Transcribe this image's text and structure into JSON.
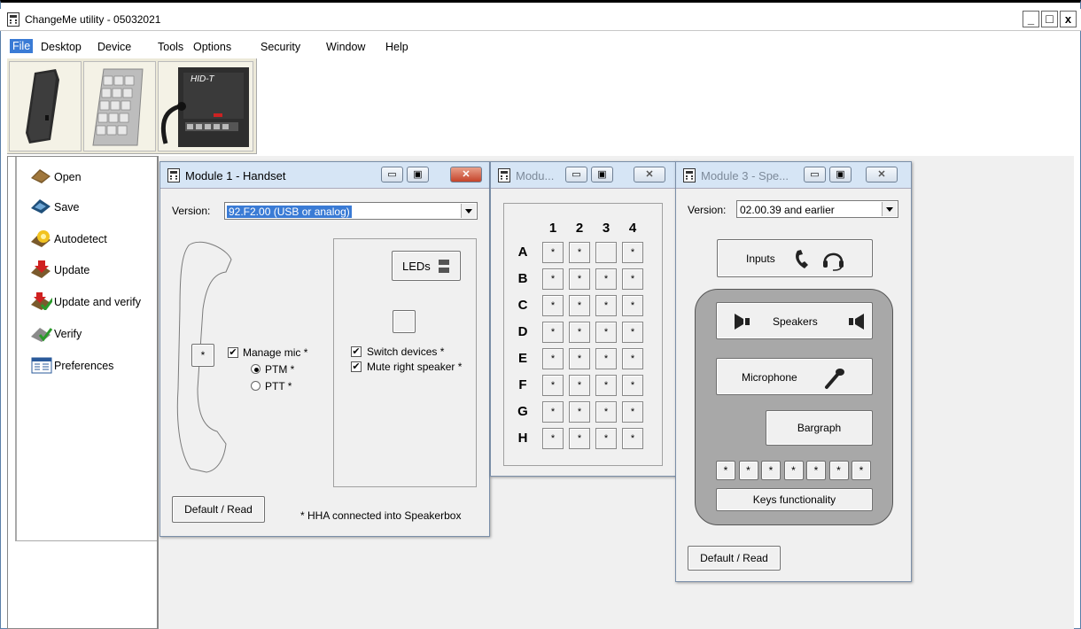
{
  "app": {
    "title": "ChangeMe utility - 05032021",
    "window_buttons": {
      "minimize": "_",
      "maximize": "□",
      "close": "x"
    }
  },
  "menu": [
    "File",
    "Desktop",
    "Device",
    "Tools",
    "Options",
    "Security",
    "Window",
    "Help"
  ],
  "toolbar": {
    "devices": [
      {
        "name": "handset",
        "label": ""
      },
      {
        "name": "keypad",
        "label": ""
      },
      {
        "name": "speakerbox",
        "label": "HID-T"
      }
    ]
  },
  "sidebar": {
    "items": [
      {
        "label": "Open",
        "icon": "open-icon"
      },
      {
        "label": "Save",
        "icon": "save-icon"
      },
      {
        "label": "Autodetect",
        "icon": "autodetect-icon"
      },
      {
        "label": "Update",
        "icon": "update-icon"
      },
      {
        "label": "Update and verify",
        "icon": "update-verify-icon"
      },
      {
        "label": "Verify",
        "icon": "verify-icon"
      },
      {
        "label": "Preferences",
        "icon": "preferences-icon"
      }
    ]
  },
  "module1": {
    "title": "Module 1 - Handset",
    "version_label": "Version:",
    "version_value": "92.F2.00 (USB or analog)",
    "leds_label": "LEDs",
    "star_button": "*",
    "manage_mic": "Manage mic *",
    "ptm": "PTM *",
    "ptt": "PTT *",
    "switch_devices": "Switch devices *",
    "mute_right": "Mute right speaker *",
    "default_read": "Default / Read",
    "note": "* HHA connected into Speakerbox",
    "checks": {
      "manage_mic": true,
      "switch_devices": true,
      "mute_right": true
    },
    "radio_selected": "PTM"
  },
  "module2": {
    "title": "Modu...",
    "columns": [
      "1",
      "2",
      "3",
      "4"
    ],
    "rows": [
      "A",
      "B",
      "C",
      "D",
      "E",
      "F",
      "G",
      "H"
    ],
    "cells": [
      [
        "*",
        "*",
        "",
        "*"
      ],
      [
        "*",
        "*",
        "*",
        "*"
      ],
      [
        "*",
        "*",
        "*",
        "*"
      ],
      [
        "*",
        "*",
        "*",
        "*"
      ],
      [
        "*",
        "*",
        "*",
        "*"
      ],
      [
        "*",
        "*",
        "*",
        "*"
      ],
      [
        "*",
        "*",
        "*",
        "*"
      ],
      [
        "*",
        "*",
        "*",
        "*"
      ]
    ]
  },
  "module3": {
    "title": "Module 3 - Spe...",
    "version_label": "Version:",
    "version_value": "02.00.39 and earlier",
    "inputs": "Inputs",
    "speakers": "Speakers",
    "microphone": "Microphone",
    "bargraph": "Bargraph",
    "keys": [
      "*",
      "*",
      "*",
      "*",
      "*",
      "*",
      "*"
    ],
    "keys_functionality": "Keys functionality",
    "default_read": "Default / Read"
  }
}
